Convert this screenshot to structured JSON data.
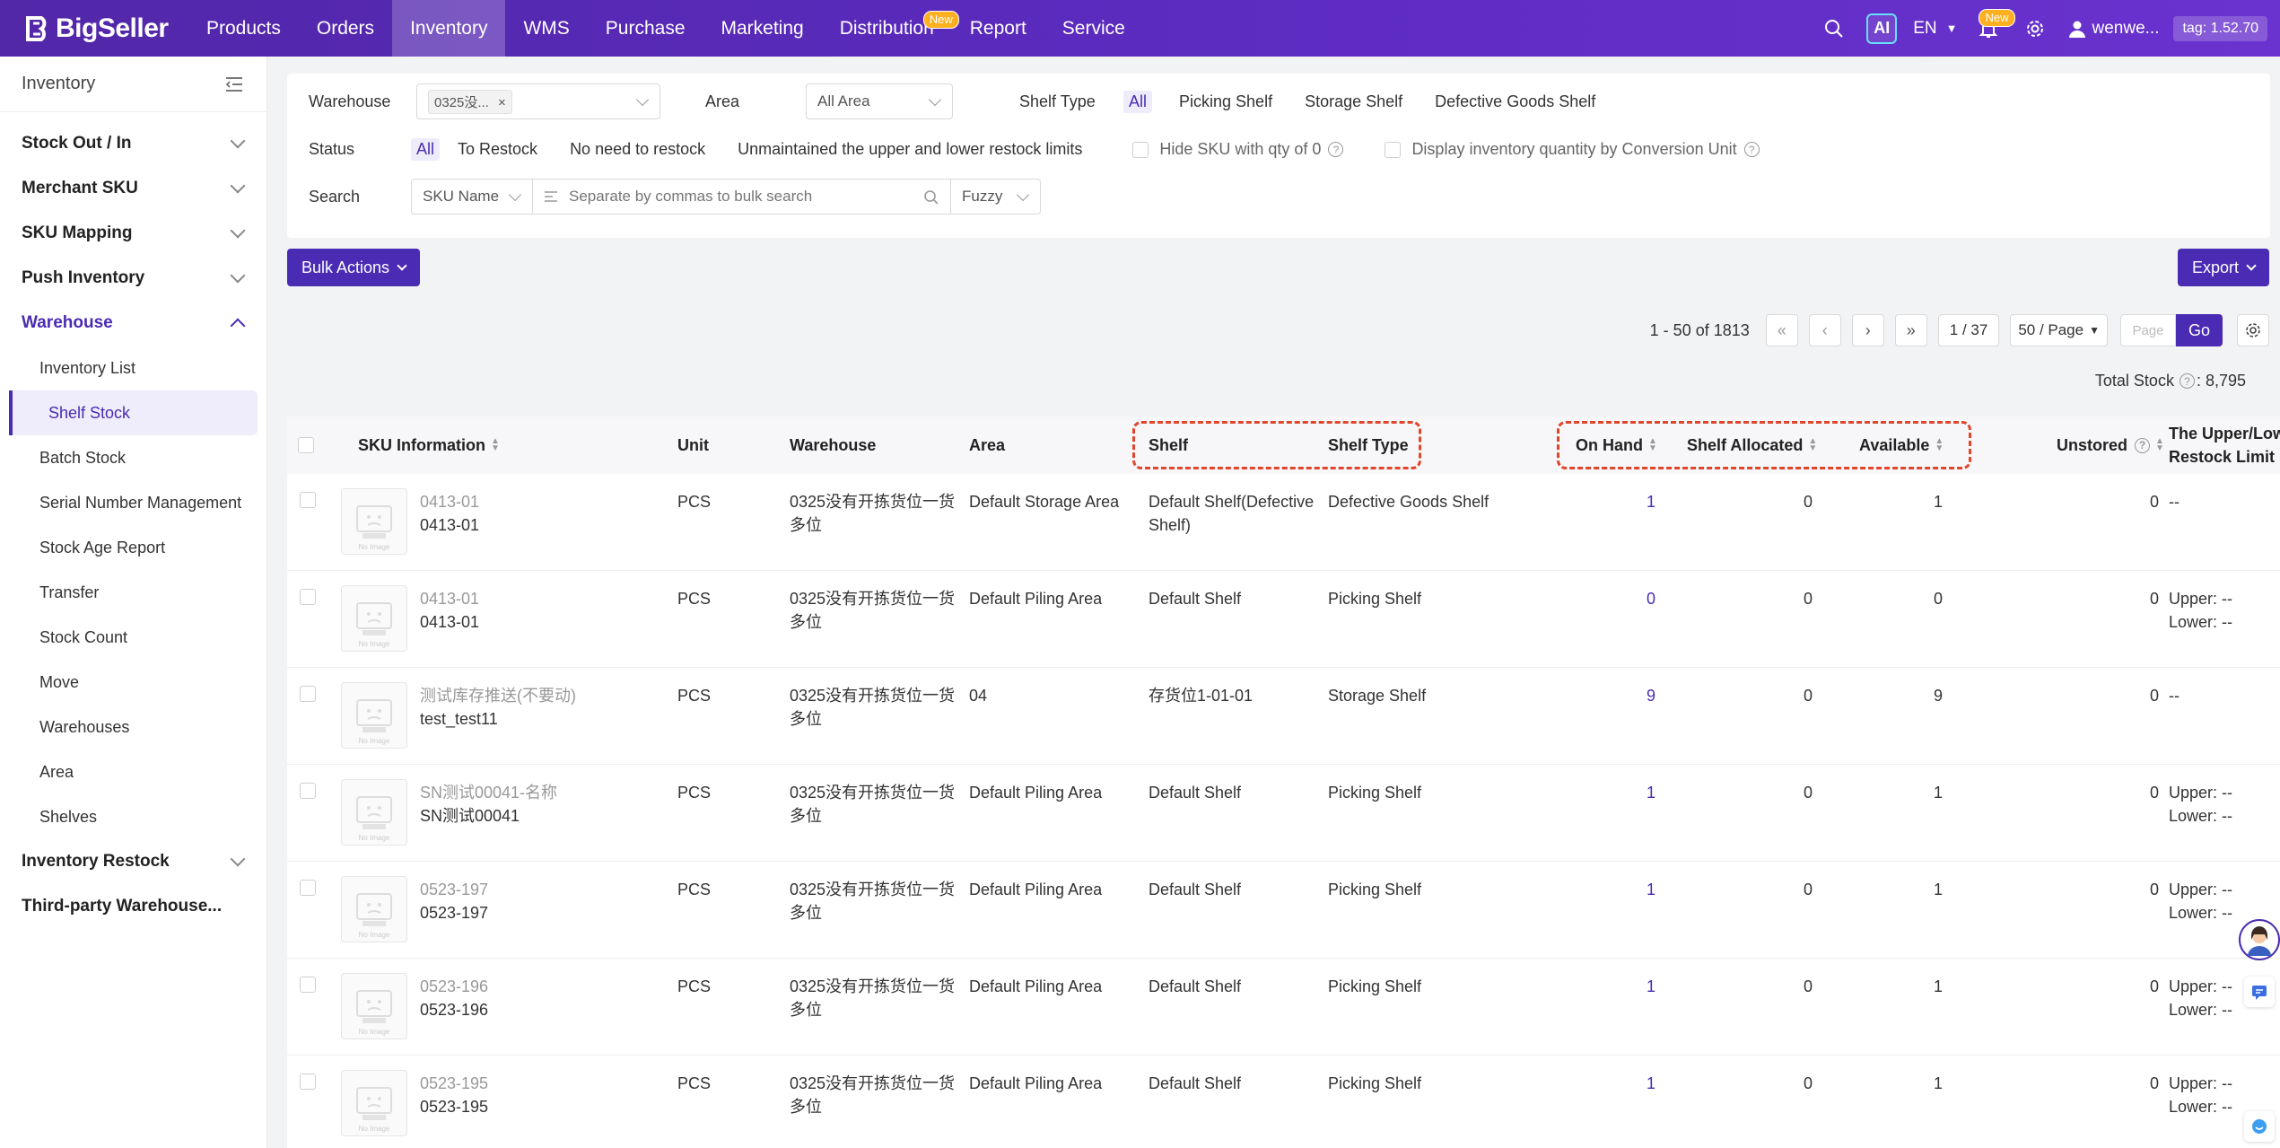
{
  "app": {
    "brand": "BigSeller",
    "nav": [
      {
        "label": "Products"
      },
      {
        "label": "Orders"
      },
      {
        "label": "Inventory",
        "active": true
      },
      {
        "label": "WMS"
      },
      {
        "label": "Purchase"
      },
      {
        "label": "Marketing"
      },
      {
        "label": "Distribution",
        "badge": "New"
      },
      {
        "label": "Report"
      },
      {
        "label": "Service"
      }
    ],
    "ai_label": "AI",
    "lang": "EN",
    "bell_badge": "New",
    "user": "wenwe...",
    "tag": "tag: 1.52.70",
    "accent": "#4a2bb3"
  },
  "sidebar": {
    "title": "Inventory",
    "groups": [
      {
        "label": "Stock Out / In"
      },
      {
        "label": "Merchant SKU"
      },
      {
        "label": "SKU Mapping"
      },
      {
        "label": "Push Inventory"
      },
      {
        "label": "Warehouse"
      },
      {
        "label": "Inventory Restock"
      },
      {
        "label": "Third-party Warehouse..."
      }
    ],
    "warehouse_items": [
      "Inventory List",
      "Shelf Stock",
      "Batch Stock",
      "Serial Number Management",
      "Stock Age Report",
      "Transfer",
      "Stock Count",
      "Move",
      "Warehouses",
      "Area",
      "Shelves"
    ]
  },
  "filters": {
    "warehouse_label": "Warehouse",
    "warehouse_chip": "0325没...",
    "area_label": "Area",
    "area_value": "All Area",
    "shelf_type_label": "Shelf Type",
    "shelf_type_options": [
      "All",
      "Picking Shelf",
      "Storage Shelf",
      "Defective Goods Shelf"
    ],
    "status_label": "Status",
    "status_options": [
      "All",
      "To Restock",
      "No need to restock",
      "Unmaintained the upper and lower restock limits"
    ],
    "hide_zero": "Hide SKU with qty of 0",
    "display_conversion": "Display inventory quantity by Conversion Unit",
    "search_label": "Search",
    "search_field": "SKU Name",
    "search_placeholder": "Separate by commas to bulk search",
    "match_mode": "Fuzzy"
  },
  "actions": {
    "bulk": "Bulk Actions",
    "export": "Export"
  },
  "pager": {
    "range": "1 - 50 of 1813",
    "page": "1 / 37",
    "page_size": "50 / Page",
    "page_placeholder": "Page",
    "go": "Go"
  },
  "total_stock": {
    "label": "Total Stock",
    "value": ": 8,795"
  },
  "table": {
    "headers": {
      "sku": "SKU Information",
      "unit": "Unit",
      "warehouse": "Warehouse",
      "area": "Area",
      "shelf": "Shelf",
      "shelf_type": "Shelf Type",
      "on_hand": "On Hand",
      "shelf_allocated": "Shelf Allocated",
      "available": "Available",
      "unstored": "Unstored",
      "limit_1": "The Upper/Lowe",
      "limit_2": "Restock Limit"
    },
    "no_image": "No Image",
    "rows": [
      {
        "name": "0413-01",
        "sku": "0413-01",
        "unit": "PCS",
        "wh1": "0325没有开拣货位一货",
        "wh2": "多位",
        "area": "Default Storage Area",
        "shelf": "Default Shelf(Defective",
        "shelf2": "Shelf)",
        "type": "Defective Goods Shelf",
        "on_hand": "1",
        "alloc": "0",
        "avail": "1",
        "unstored": "0",
        "upper": "--",
        "lower": ""
      },
      {
        "name": "0413-01",
        "sku": "0413-01",
        "unit": "PCS",
        "wh1": "0325没有开拣货位一货",
        "wh2": "多位",
        "area": "Default Piling Area",
        "shelf": "Default Shelf",
        "shelf2": "",
        "type": "Picking Shelf",
        "on_hand": "0",
        "alloc": "0",
        "avail": "0",
        "unstored": "0",
        "upper": "Upper: --",
        "lower": "Lower: --"
      },
      {
        "name": "测试库存推送(不要动)",
        "sku": "test_test11",
        "unit": "PCS",
        "wh1": "0325没有开拣货位一货",
        "wh2": "多位",
        "area": "04",
        "shelf": "存货位1-01-01",
        "shelf2": "",
        "type": "Storage Shelf",
        "on_hand": "9",
        "alloc": "0",
        "avail": "9",
        "unstored": "0",
        "upper": "--",
        "lower": ""
      },
      {
        "name": "SN测试00041-名称",
        "sku": "SN测试00041",
        "unit": "PCS",
        "wh1": "0325没有开拣货位一货",
        "wh2": "多位",
        "area": "Default Piling Area",
        "shelf": "Default Shelf",
        "shelf2": "",
        "type": "Picking Shelf",
        "on_hand": "1",
        "alloc": "0",
        "avail": "1",
        "unstored": "0",
        "upper": "Upper: --",
        "lower": "Lower: --"
      },
      {
        "name": "0523-197",
        "sku": "0523-197",
        "unit": "PCS",
        "wh1": "0325没有开拣货位一货",
        "wh2": "多位",
        "area": "Default Piling Area",
        "shelf": "Default Shelf",
        "shelf2": "",
        "type": "Picking Shelf",
        "on_hand": "1",
        "alloc": "0",
        "avail": "1",
        "unstored": "0",
        "upper": "Upper: --",
        "lower": "Lower: --"
      },
      {
        "name": "0523-196",
        "sku": "0523-196",
        "unit": "PCS",
        "wh1": "0325没有开拣货位一货",
        "wh2": "多位",
        "area": "Default Piling Area",
        "shelf": "Default Shelf",
        "shelf2": "",
        "type": "Picking Shelf",
        "on_hand": "1",
        "alloc": "0",
        "avail": "1",
        "unstored": "0",
        "upper": "Upper: --",
        "lower": "Lower: --"
      },
      {
        "name": "0523-195",
        "sku": "0523-195",
        "unit": "PCS",
        "wh1": "0325没有开拣货位一货",
        "wh2": "多位",
        "area": "Default Piling Area",
        "shelf": "Default Shelf",
        "shelf2": "",
        "type": "Picking Shelf",
        "on_hand": "1",
        "alloc": "0",
        "avail": "1",
        "unstored": "0",
        "upper": "Upper: --",
        "lower": "Lower: --"
      }
    ]
  }
}
